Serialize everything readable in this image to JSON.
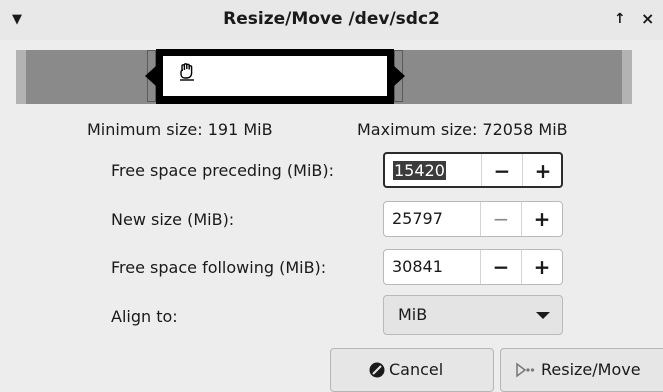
{
  "titlebar": {
    "title": "Resize/Move /dev/sdc2",
    "menu_icon": "triangle-down-icon",
    "up_icon": "arrow-up-icon",
    "close_icon": "close-icon"
  },
  "partition_graphic": {
    "drag_icon": "hand-drag-icon"
  },
  "limits": {
    "minimum": "Minimum size: 191 MiB",
    "maximum": "Maximum size: 72058 MiB"
  },
  "fields": {
    "free_preceding": {
      "label": "Free space preceding (MiB):",
      "value": "15420"
    },
    "new_size": {
      "label": "New size (MiB):",
      "value": "25797"
    },
    "free_following": {
      "label": "Free space following (MiB):",
      "value": "30841"
    },
    "align": {
      "label": "Align to:",
      "value": "MiB"
    }
  },
  "spin_symbols": {
    "minus": "−",
    "plus": "+"
  },
  "buttons": {
    "cancel": {
      "label": "Cancel",
      "icon": "cancel-circle-icon"
    },
    "resize": {
      "label": "Resize/Move",
      "icon": "resize-move-icon"
    }
  }
}
